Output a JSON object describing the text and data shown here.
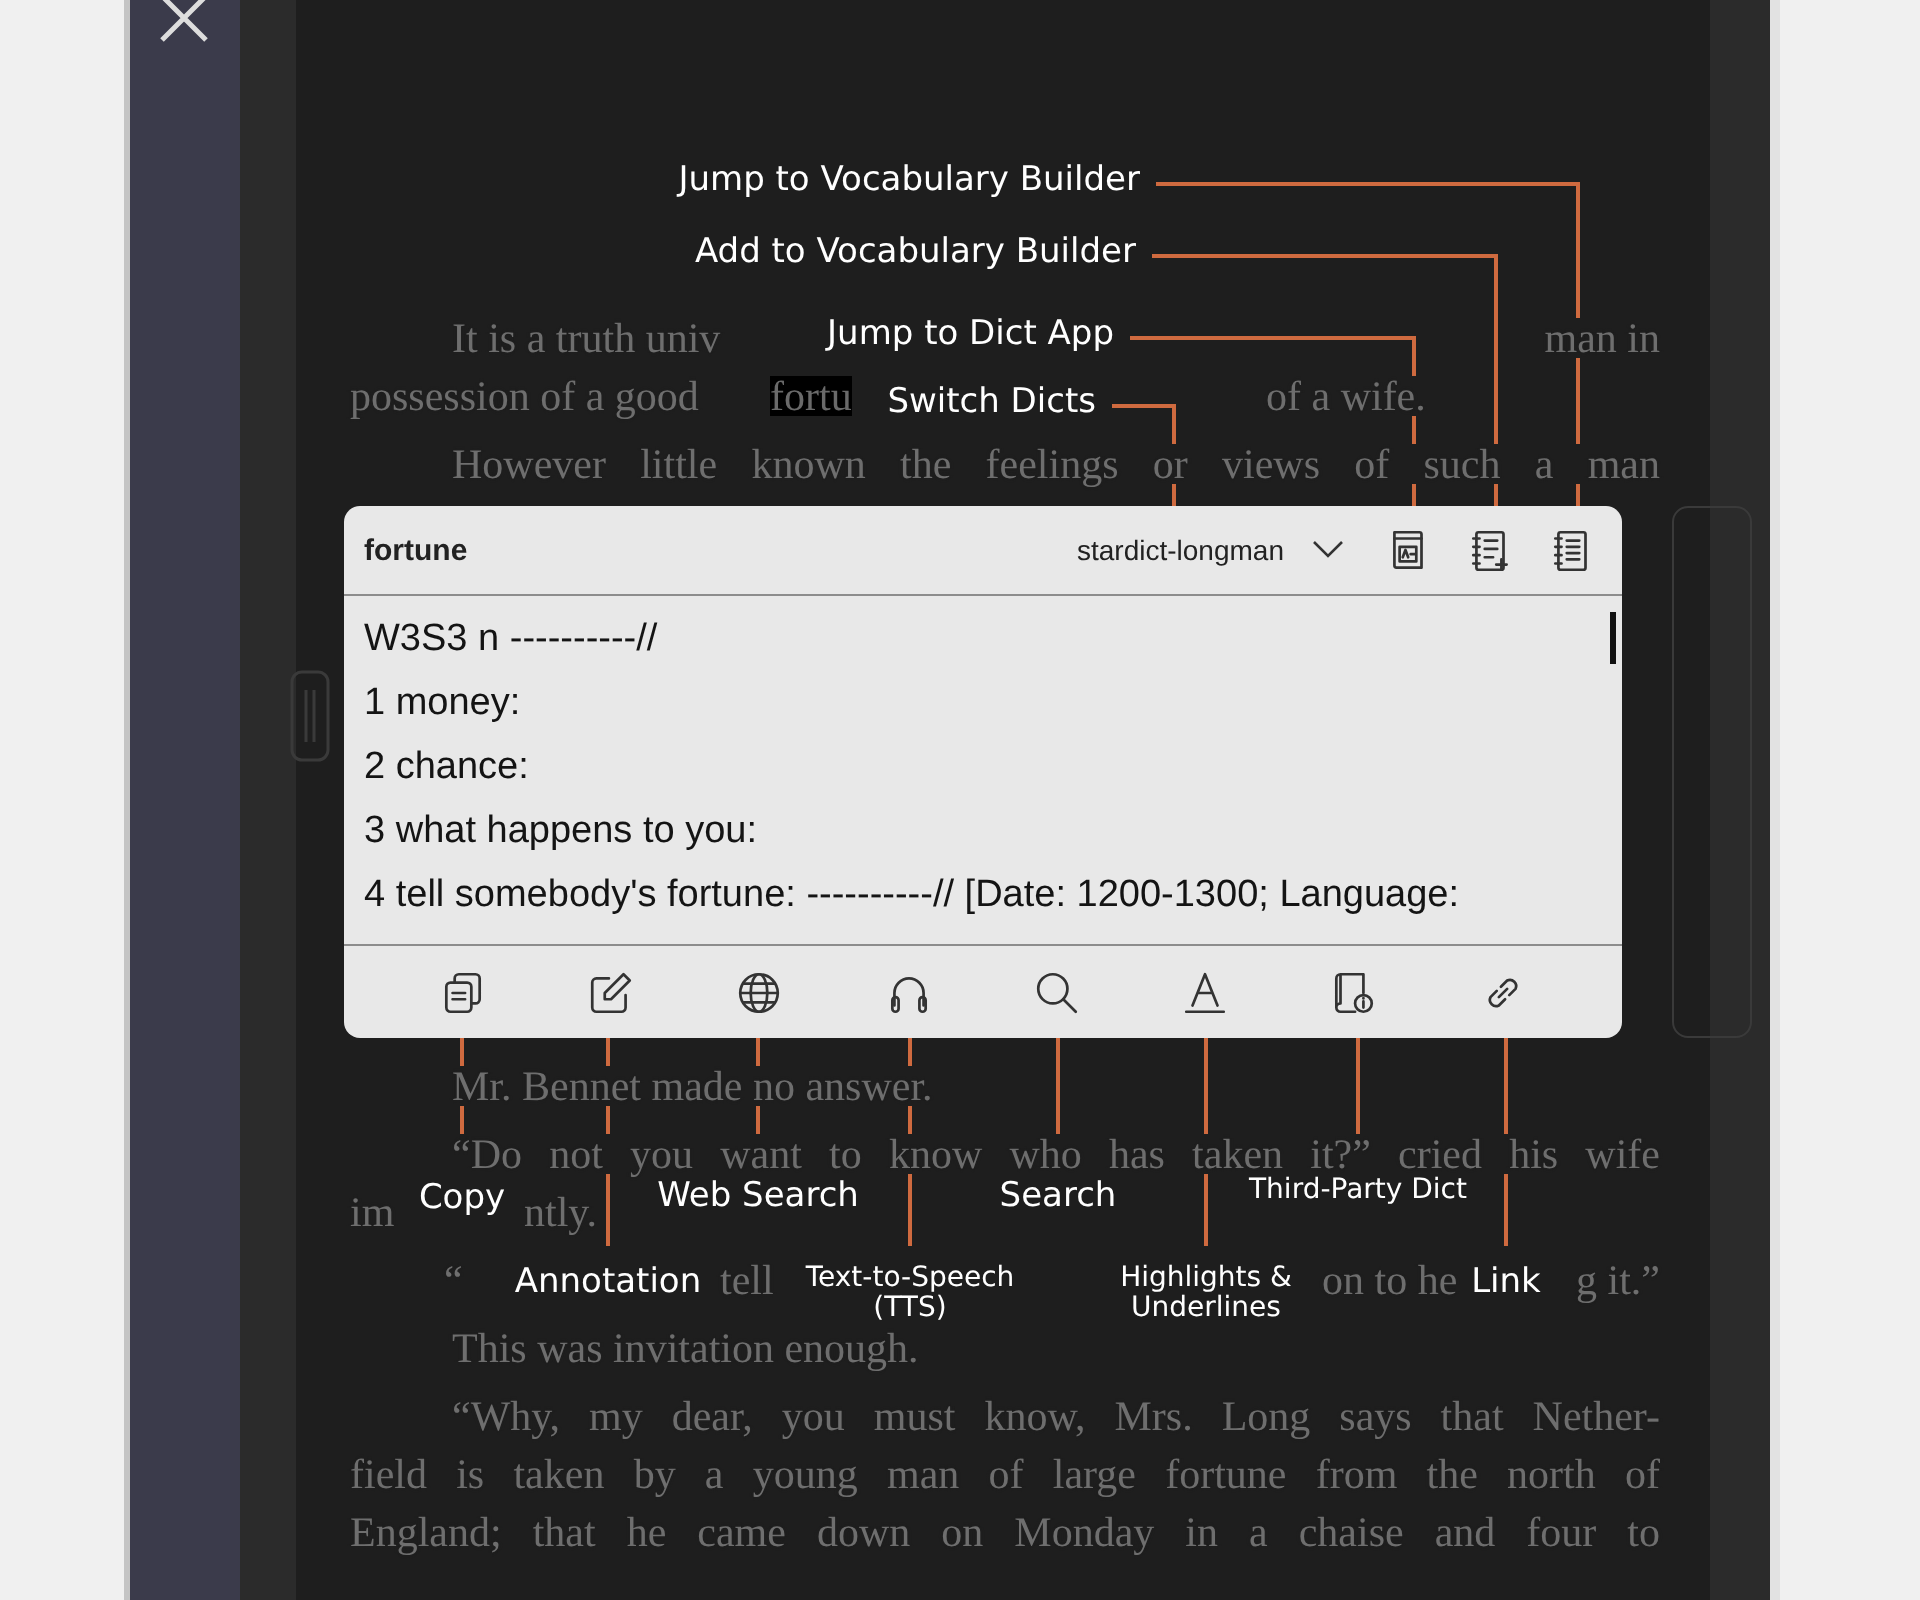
{
  "book": {
    "top_paragraphs": [
      {
        "lines": [
          {
            "parts": [
              {
                "text": "It is a truth univ",
                "selected": false
              },
              {
                "text": "man in",
                "selected": false
              }
            ]
          },
          {
            "parts": [
              {
                "text": "possession of a good ",
                "selected": false
              },
              {
                "text": "fortu",
                "selected": true
              },
              {
                "text": "of a wife.",
                "selected": false
              }
            ]
          }
        ]
      },
      {
        "lines": [
          {
            "text": "However little known the feelings or views of such a man"
          }
        ]
      }
    ],
    "bottom_paragraphs": [
      {
        "lines": [
          {
            "text": "Mr. Bennet made no answer."
          }
        ]
      },
      {
        "lines": [
          {
            "text": "“Do not you want to know who has taken it?” cried his wife"
          },
          {
            "parts": [
              {
                "text": "im",
                "selected": false
              },
              {
                "text": "ntly.",
                "selected": false
              }
            ]
          }
        ]
      },
      {
        "lines": [
          {
            "parts": [
              {
                "text": "“",
                "selected": false
              },
              {
                "text": "tell",
                "selected": false
              },
              {
                "text": "on to he",
                "selected": false
              },
              {
                "text": "g it.”",
                "selected": false
              }
            ]
          }
        ]
      },
      {
        "lines": [
          {
            "text": "This was invitation enough."
          }
        ]
      },
      {
        "lines": [
          {
            "text": "“Why, my dear, you must know, Mrs. Long says that Nether-"
          },
          {
            "text": "field is taken by a young man of large fortune from the north of"
          },
          {
            "text": "England; that he came down on Monday in a chaise and four to"
          }
        ]
      }
    ]
  },
  "dictionary_popup": {
    "word": "fortune",
    "dictionary": "stardict-longman",
    "definition_lines": [
      "W3S3 n ----------//",
      "1 money:",
      "2 chance:",
      "3 what happens to you:",
      "4 tell somebody's fortune: ----------// [Date: 1200-1300; Language:"
    ]
  },
  "top_callouts": [
    {
      "label": "Jump to Vocabulary Builder"
    },
    {
      "label": "Add to Vocabulary Builder"
    },
    {
      "label": "Jump to Dict App"
    },
    {
      "label": "Switch Dicts"
    }
  ],
  "bottom_callouts": [
    {
      "label": "Copy"
    },
    {
      "label": "Annotation"
    },
    {
      "label": "Web Search"
    },
    {
      "label": "Text-to-Speech (TTS)"
    },
    {
      "label": "Search"
    },
    {
      "label": "Highlights & Underlines"
    },
    {
      "label": "Third-Party Dict"
    },
    {
      "label": "Link"
    }
  ]
}
